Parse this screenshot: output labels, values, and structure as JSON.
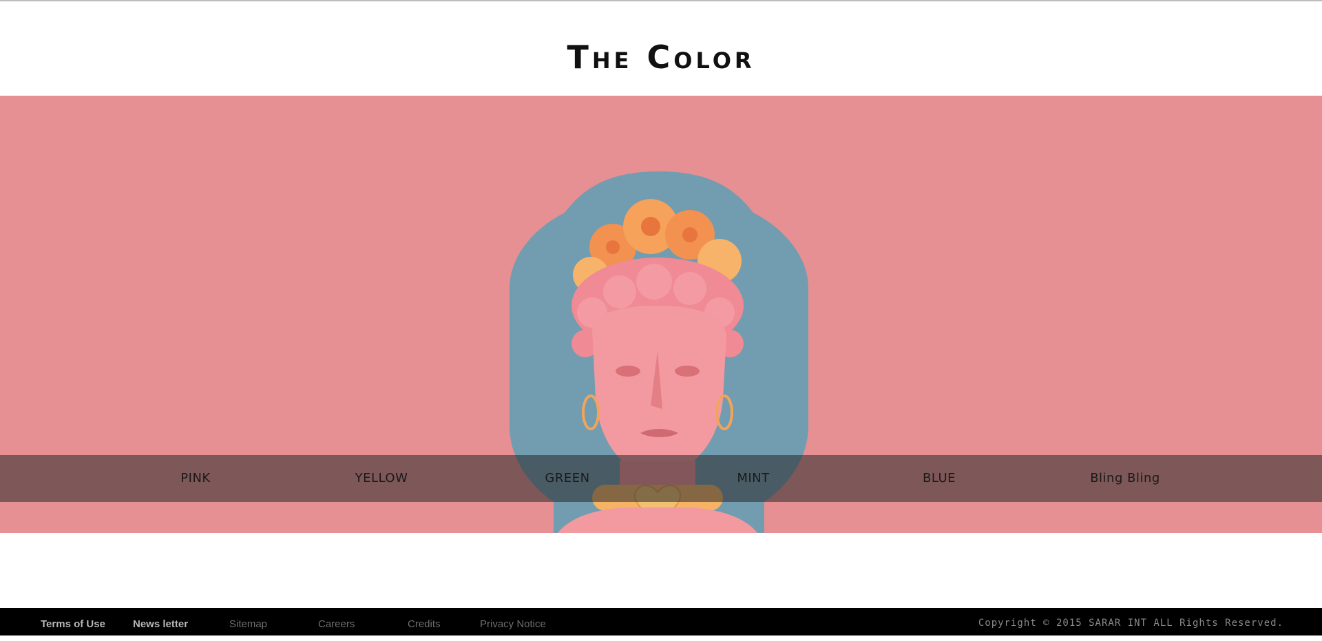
{
  "header": {
    "title": "The Color"
  },
  "hero": {
    "background_color": "#e79093",
    "art_background_color": "#729caf",
    "art_description_icon": "statue-bust-icon"
  },
  "color_nav": {
    "items": [
      {
        "label": "PINK"
      },
      {
        "label": "YELLOW"
      },
      {
        "label": "GREEN"
      },
      {
        "label": "MINT"
      },
      {
        "label": "BLUE"
      },
      {
        "label": "Bling Bling"
      }
    ]
  },
  "footer": {
    "links": [
      {
        "label": "Terms of Use"
      },
      {
        "label": "News letter"
      },
      {
        "label": "Sitemap"
      },
      {
        "label": "Careers"
      },
      {
        "label": "Credits"
      },
      {
        "label": "Privacy Notice"
      }
    ],
    "copyright": "Copyright © 2015 SARAR INT ALL Rights Reserved."
  }
}
